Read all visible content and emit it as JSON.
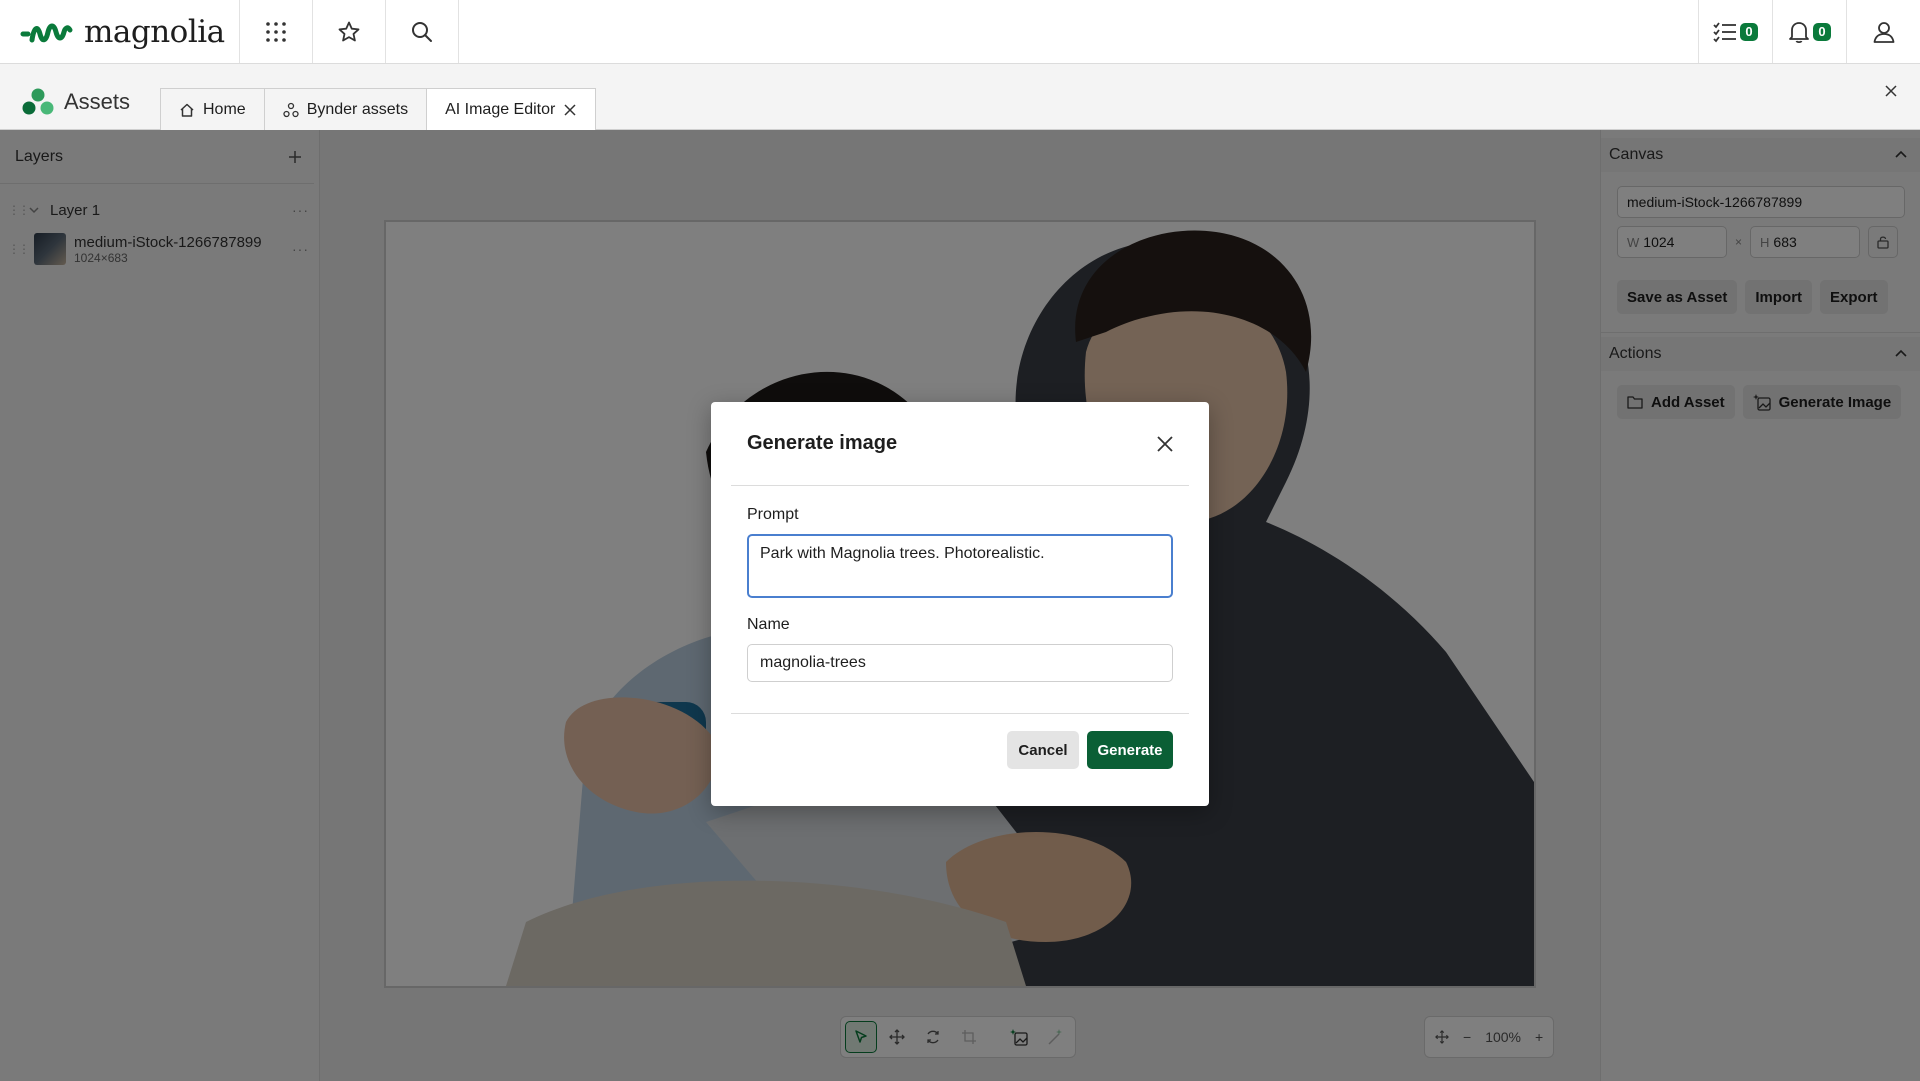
{
  "topbar": {
    "logo_text": "magnolia",
    "tasks_count": "0",
    "notifications_count": "0"
  },
  "app": {
    "name": "Assets",
    "tabs": [
      {
        "label": "Home",
        "icon": "home-icon"
      },
      {
        "label": "Bynder assets",
        "icon": "bynder-icon"
      },
      {
        "label": "AI Image Editor",
        "icon": "close-icon"
      }
    ]
  },
  "layers": {
    "title": "Layers",
    "layer_name": "Layer 1",
    "asset_name": "medium-iStock-1266787899",
    "asset_dims": "1024×683"
  },
  "canvas_panel": {
    "title": "Canvas",
    "name_value": "medium-iStock-1266787899",
    "w_label": "W",
    "w_value": "1024",
    "times": "×",
    "h_label": "H",
    "h_value": "683",
    "save_label": "Save as Asset",
    "import_label": "Import",
    "export_label": "Export"
  },
  "actions_panel": {
    "title": "Actions",
    "add_asset_label": "Add Asset",
    "generate_image_label": "Generate Image"
  },
  "zoom": {
    "level": "100%",
    "minus": "−",
    "plus": "+"
  },
  "modal": {
    "title": "Generate image",
    "prompt_label": "Prompt",
    "prompt_value": "Park with Magnolia trees. Photorealistic.",
    "name_label": "Name",
    "name_value": "magnolia-trees",
    "cancel_label": "Cancel",
    "generate_label": "Generate"
  },
  "colors": {
    "brand_green": "#0a7a3b",
    "primary_button": "#0a5f35",
    "focus_border": "#4a7fcf"
  }
}
